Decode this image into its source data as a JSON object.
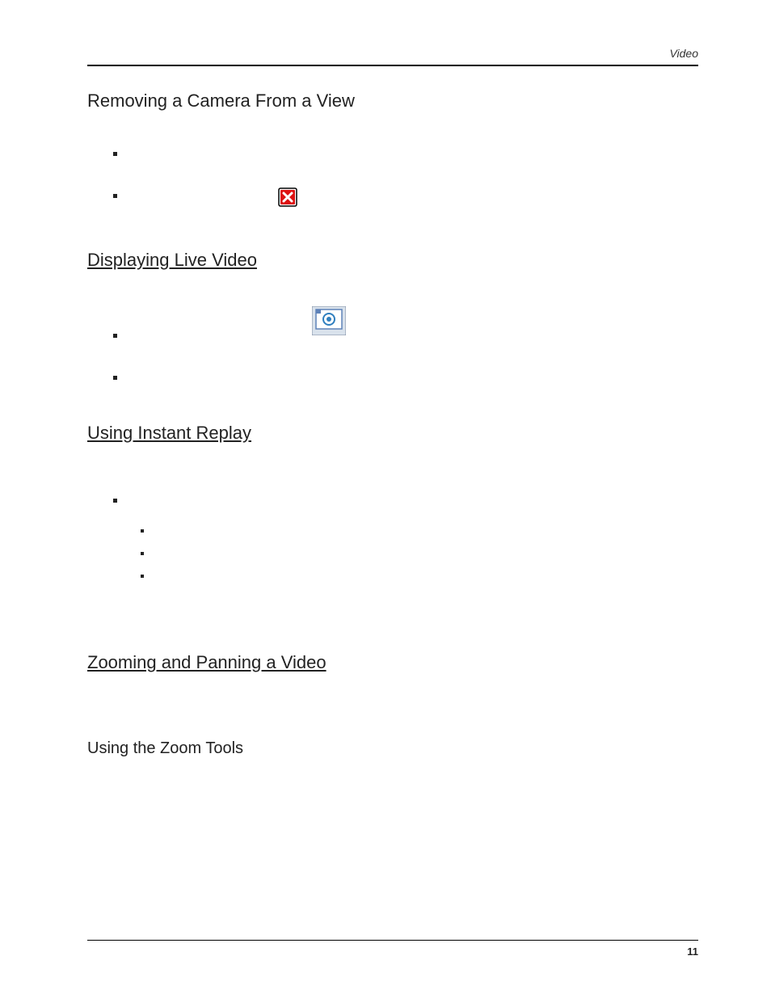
{
  "header": {
    "running_head": "Video"
  },
  "footer": {
    "page_number": "11"
  },
  "sections": {
    "remove_camera": {
      "title": "Removing a Camera From a View"
    },
    "live_video": {
      "title": "Displaying Live Video"
    },
    "instant_replay": {
      "title": "Using Instant Replay"
    },
    "zoom_pan": {
      "title": "Zooming and Panning a Video"
    },
    "zoom_tools": {
      "title": "Using the Zoom Tools"
    }
  }
}
